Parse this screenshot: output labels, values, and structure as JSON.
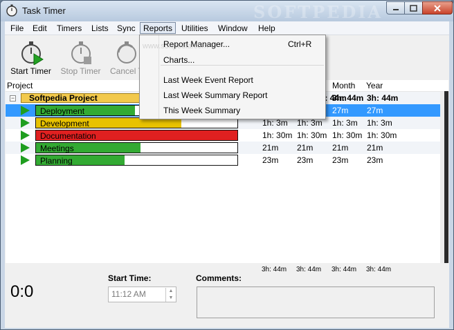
{
  "window": {
    "title": "Task Timer",
    "watermark": "SOFTPEDIA",
    "url_watermark": "www.softpedia.com"
  },
  "menubar": {
    "items": [
      {
        "label": "File"
      },
      {
        "label": "Edit"
      },
      {
        "label": "Timers"
      },
      {
        "label": "Lists"
      },
      {
        "label": "Sync"
      },
      {
        "label": "Reports"
      },
      {
        "label": "Utilities"
      },
      {
        "label": "Window"
      },
      {
        "label": "Help"
      }
    ],
    "active": "Reports"
  },
  "toolbar": {
    "start_label": "Start Timer",
    "stop_label": "Stop Timer",
    "cancel_label": "Cancel T"
  },
  "reports_menu": {
    "items": [
      {
        "label": "Report Manager...",
        "shortcut": "Ctrl+R"
      },
      {
        "label": "Charts...",
        "shortcut": ""
      },
      {
        "label": "Last Week Event Report",
        "shortcut": ""
      },
      {
        "label": "Last Week Summary Report",
        "shortcut": ""
      },
      {
        "label": "This Week Summary",
        "shortcut": ""
      }
    ]
  },
  "grid": {
    "headers": {
      "project": "Project",
      "month": "Month",
      "year": "Year"
    },
    "project_row": {
      "name": "Softpedia Project",
      "day": "h: 44m",
      "month": "3h: 44m",
      "year": "3h: 44m"
    },
    "tasks": [
      {
        "name": "Deployment",
        "fill": 0.49,
        "color": "#33aa33",
        "c1": "",
        "c2": "",
        "c3": "27m",
        "c4": "27m",
        "selected": true
      },
      {
        "name": "Development",
        "fill": 0.72,
        "color": "#e8c200",
        "c1": "1h: 3m",
        "c2": "1h: 3m",
        "c3": "1h: 3m",
        "c4": "1h: 3m",
        "selected": false
      },
      {
        "name": "Documentation",
        "fill": 1.0,
        "color": "#e02020",
        "c1": "1h: 30m",
        "c2": "1h: 30m",
        "c3": "1h: 30m",
        "c4": "1h: 30m",
        "selected": false
      },
      {
        "name": "Meetings",
        "fill": 0.52,
        "color": "#33aa33",
        "c1": "21m",
        "c2": "21m",
        "c3": "21m",
        "c4": "21m",
        "selected": false
      },
      {
        "name": "Planning",
        "fill": 0.44,
        "color": "#33aa33",
        "c1": "23m",
        "c2": "23m",
        "c3": "23m",
        "c4": "23m",
        "selected": false
      }
    ]
  },
  "bottom": {
    "totals": [
      "3h: 44m",
      "3h: 44m",
      "3h: 44m",
      "3h: 44m"
    ],
    "timer": "0:0",
    "start_time_label": "Start Time:",
    "start_time_value": "11:12 AM",
    "comments_label": "Comments:"
  },
  "colors": {
    "selected_row": "#3399ff",
    "project_bar": "#f2c94c"
  }
}
